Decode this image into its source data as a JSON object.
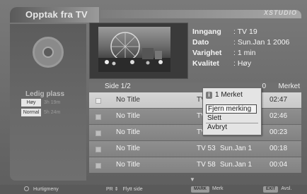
{
  "header": {
    "title": "Opptak fra TV",
    "logo": "XSTUDIO"
  },
  "storage": {
    "label": "Ledig plass",
    "qualities": [
      {
        "label": "Høy",
        "time": "3h  19m",
        "selected": true
      },
      {
        "label": "Normal",
        "time": "5h  24m",
        "selected": true
      }
    ]
  },
  "details": {
    "rows": [
      {
        "label": "Inngang",
        "value": ": TV 19"
      },
      {
        "label": "Dato",
        "value": ": Sun.Jan 1 2006"
      },
      {
        "label": "Varighet",
        "value": ": 1 min"
      },
      {
        "label": "Kvalitet",
        "value": ": Høy"
      }
    ]
  },
  "list": {
    "page_indicator": "Side  1/2",
    "mark_count": "0",
    "mark_label": "Merket",
    "rows": [
      {
        "title": "No Title",
        "channel": "TV 1",
        "date": "",
        "time": "02:47",
        "selected": true
      },
      {
        "title": "No Title",
        "channel": "TV 1",
        "date": "",
        "time": "02:46",
        "selected": false
      },
      {
        "title": "No Title",
        "channel": "TV 5",
        "date": "",
        "time": "00:23",
        "selected": false
      },
      {
        "title": "No Title",
        "channel": "TV 53",
        "date": "Sun.Jan 1",
        "time": "00:18",
        "selected": false
      },
      {
        "title": "No Title",
        "channel": "TV 58",
        "date": "Sun.Jan 1",
        "time": "00:04",
        "selected": false
      }
    ]
  },
  "popup": {
    "header": "1  Merket",
    "info_icon": "i",
    "items": [
      "Fjern merking",
      "Slett",
      "Avbryt"
    ]
  },
  "footer": {
    "quick_menu": "Hurtigmeny",
    "move_key": "PR",
    "move_label": "Flytt side",
    "mark_key": "MARK",
    "mark_label": "Merk",
    "exit_key": "EXIT",
    "exit_label": "Avsl."
  }
}
